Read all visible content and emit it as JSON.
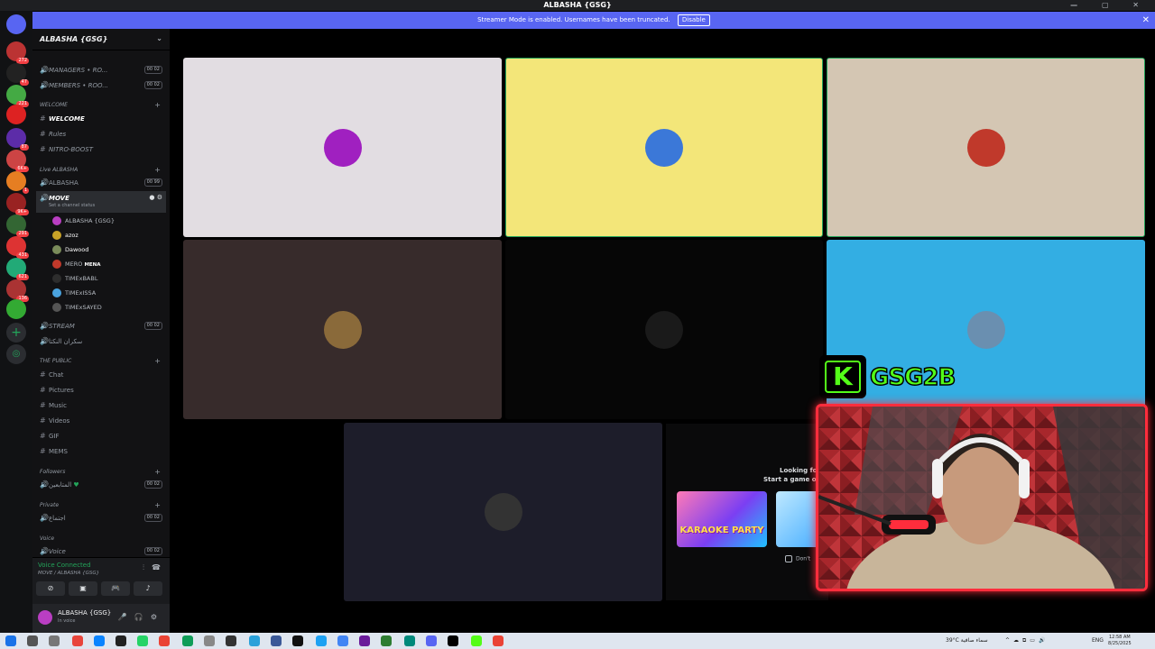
{
  "window": {
    "title": "ALBASHA {GSG}"
  },
  "banner": {
    "text": "Streamer Mode is enabled. Usernames have been truncated.",
    "button": "Disable"
  },
  "guild_badges": [
    "272",
    "47",
    "221",
    "87",
    "6K+",
    "1",
    "9K+",
    "291",
    "431",
    "621",
    "136"
  ],
  "server": {
    "name": "ALBASHA {GSG}"
  },
  "channels_top": [
    {
      "label": "MANAGERS • RO...",
      "count": "00 02"
    },
    {
      "label": "MEMBERS • ROO...",
      "count": "00 02"
    }
  ],
  "cat_welcome": "WELCOME",
  "welcome_channels": [
    "WELCOME",
    "Rules",
    "NITRO-BOOST"
  ],
  "cat_live": "Live ALBASHA",
  "live_channels": [
    {
      "label": "ALBASHA",
      "count": "00 99"
    }
  ],
  "move_channel": {
    "label": "MOVE",
    "status": "Set a channel status"
  },
  "voice_users": [
    {
      "name": "ALBASHA {GSG}",
      "color": "#b93ec2"
    },
    {
      "name": "azoz",
      "color": "#c9a227"
    },
    {
      "name": "Dawood",
      "color": "#7a8b5a"
    },
    {
      "name": "MERO",
      "tag": "MENA",
      "color": "#c0392b"
    },
    {
      "name": "TIMExBABL",
      "color": "#2d2d2d"
    },
    {
      "name": "TIMExISSA",
      "color": "#4aa3df"
    },
    {
      "name": "TIMExSAYED",
      "color": "#555"
    }
  ],
  "stream_channel": {
    "label": "STREAM",
    "count": "00 02"
  },
  "arabic_channel": "سكران النكتا",
  "cat_public": "THE PUBLIC",
  "public_channels": [
    "Chat",
    "Pictures",
    "Music",
    "Videos",
    "GIF",
    "MEMS"
  ],
  "cat_followers": "Followers",
  "followers_channel": {
    "label": "المتابعين",
    "count": "00 02"
  },
  "cat_private": "Private",
  "private_channel": {
    "label": "اجتماع",
    "count": "00 02"
  },
  "cat_voice": "Voice",
  "voice_channel": {
    "label": "Voice",
    "count": "00 02"
  },
  "voice_status": {
    "title": "Voice Connected",
    "sub": "MOVE / ALBASHA {GSG}"
  },
  "user": {
    "name": "ALBASHA {GSG}",
    "status": "In voice"
  },
  "activity": {
    "line1": "Looking for",
    "line2": "Start a game or",
    "karaoke": "KARAOKE PARTY",
    "dont_show": "Don't"
  },
  "kick": {
    "logo": "K",
    "name": "GSG2B"
  },
  "taskbar": {
    "weather": "39°C  سماء صافية",
    "lang": "ENG",
    "time": "12:58 AM",
    "date": "8/25/2025"
  },
  "tiles": [
    {
      "color": "#e2dde2",
      "avatar": "#a020c0"
    },
    {
      "color": "#f3e679",
      "avatar": "#3b78d8"
    },
    {
      "color": "#d4c6b3",
      "avatar": "#c0392b"
    },
    {
      "color": "#372b2b",
      "avatar": "#8a6a3a"
    },
    {
      "color": "#060606",
      "avatar": "#1a1a1a"
    },
    {
      "color": "#33aee3",
      "avatar": "#6a8fb0"
    },
    {
      "color": "#1d1d2a",
      "avatar": "#333"
    }
  ]
}
